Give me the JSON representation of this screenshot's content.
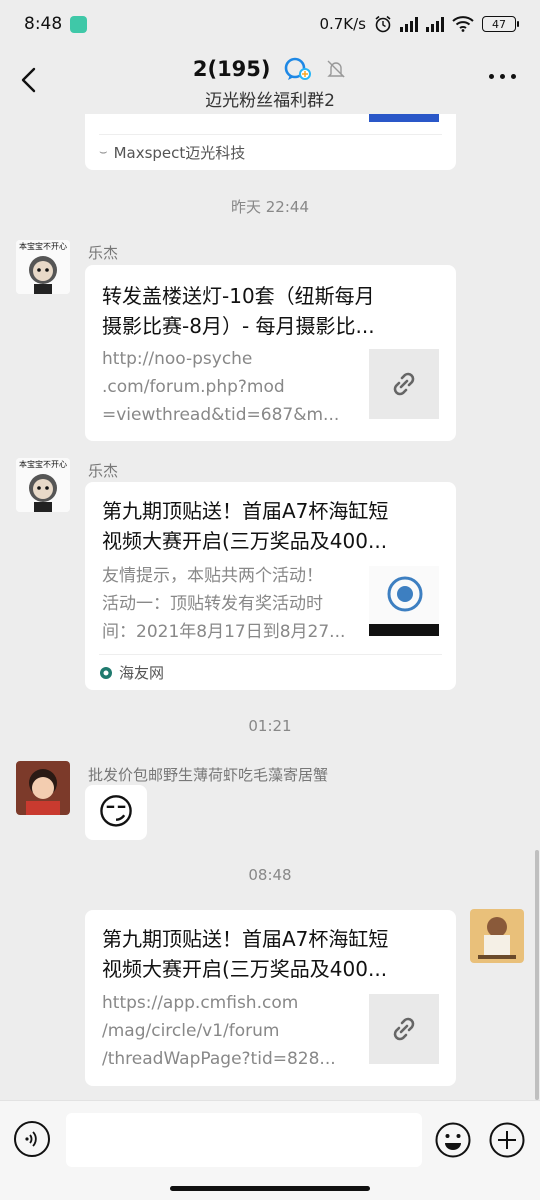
{
  "status_bar": {
    "time": "8:48",
    "speed": "0.7K/s",
    "net1": "HD",
    "net2": "HD",
    "battery": "47"
  },
  "header": {
    "title": "2(195)",
    "subtitle": "迈光粉丝福利群2",
    "accent": "#1e88e5"
  },
  "chat": {
    "partial_source": "Maxspect迈光科技",
    "ts1": "昨天 22:44",
    "msg1": {
      "sender": "乐杰",
      "avatar_caption": "本宝宝不开心",
      "title": [
        "转发盖楼送灯-10套（纽斯每月",
        "摄影比赛-8月）- 每月摄影比..."
      ],
      "desc": [
        "http://noo-psyche",
        ".com/forum.php?mod",
        "=viewthread&tid=687&m..."
      ]
    },
    "msg2": {
      "sender": "乐杰",
      "avatar_caption": "本宝宝不开心",
      "title": [
        "第九期顶贴送！首届A7杯海缸短",
        "视频大赛开启(三万奖品及400..."
      ],
      "desc": [
        "友情提示，本贴共两个活动！",
        "活动一：顶贴转发有奖活动时",
        "间：2021年8月17日到8月27..."
      ],
      "source": "海友网"
    },
    "ts2": "01:21",
    "msg3": {
      "sender": "批发价包邮野生薄荷虾吃毛藻寄居蟹",
      "emoji": "😏"
    },
    "ts3": "08:48",
    "msg4": {
      "title": [
        "第九期顶贴送！首届A7杯海缸短",
        "视频大赛开启(三万奖品及400..."
      ],
      "desc": [
        "https://app.cmfish.com",
        "/mag/circle/v1/forum",
        "/threadWapPage?tid=828..."
      ]
    }
  },
  "input": {
    "placeholder": ""
  }
}
